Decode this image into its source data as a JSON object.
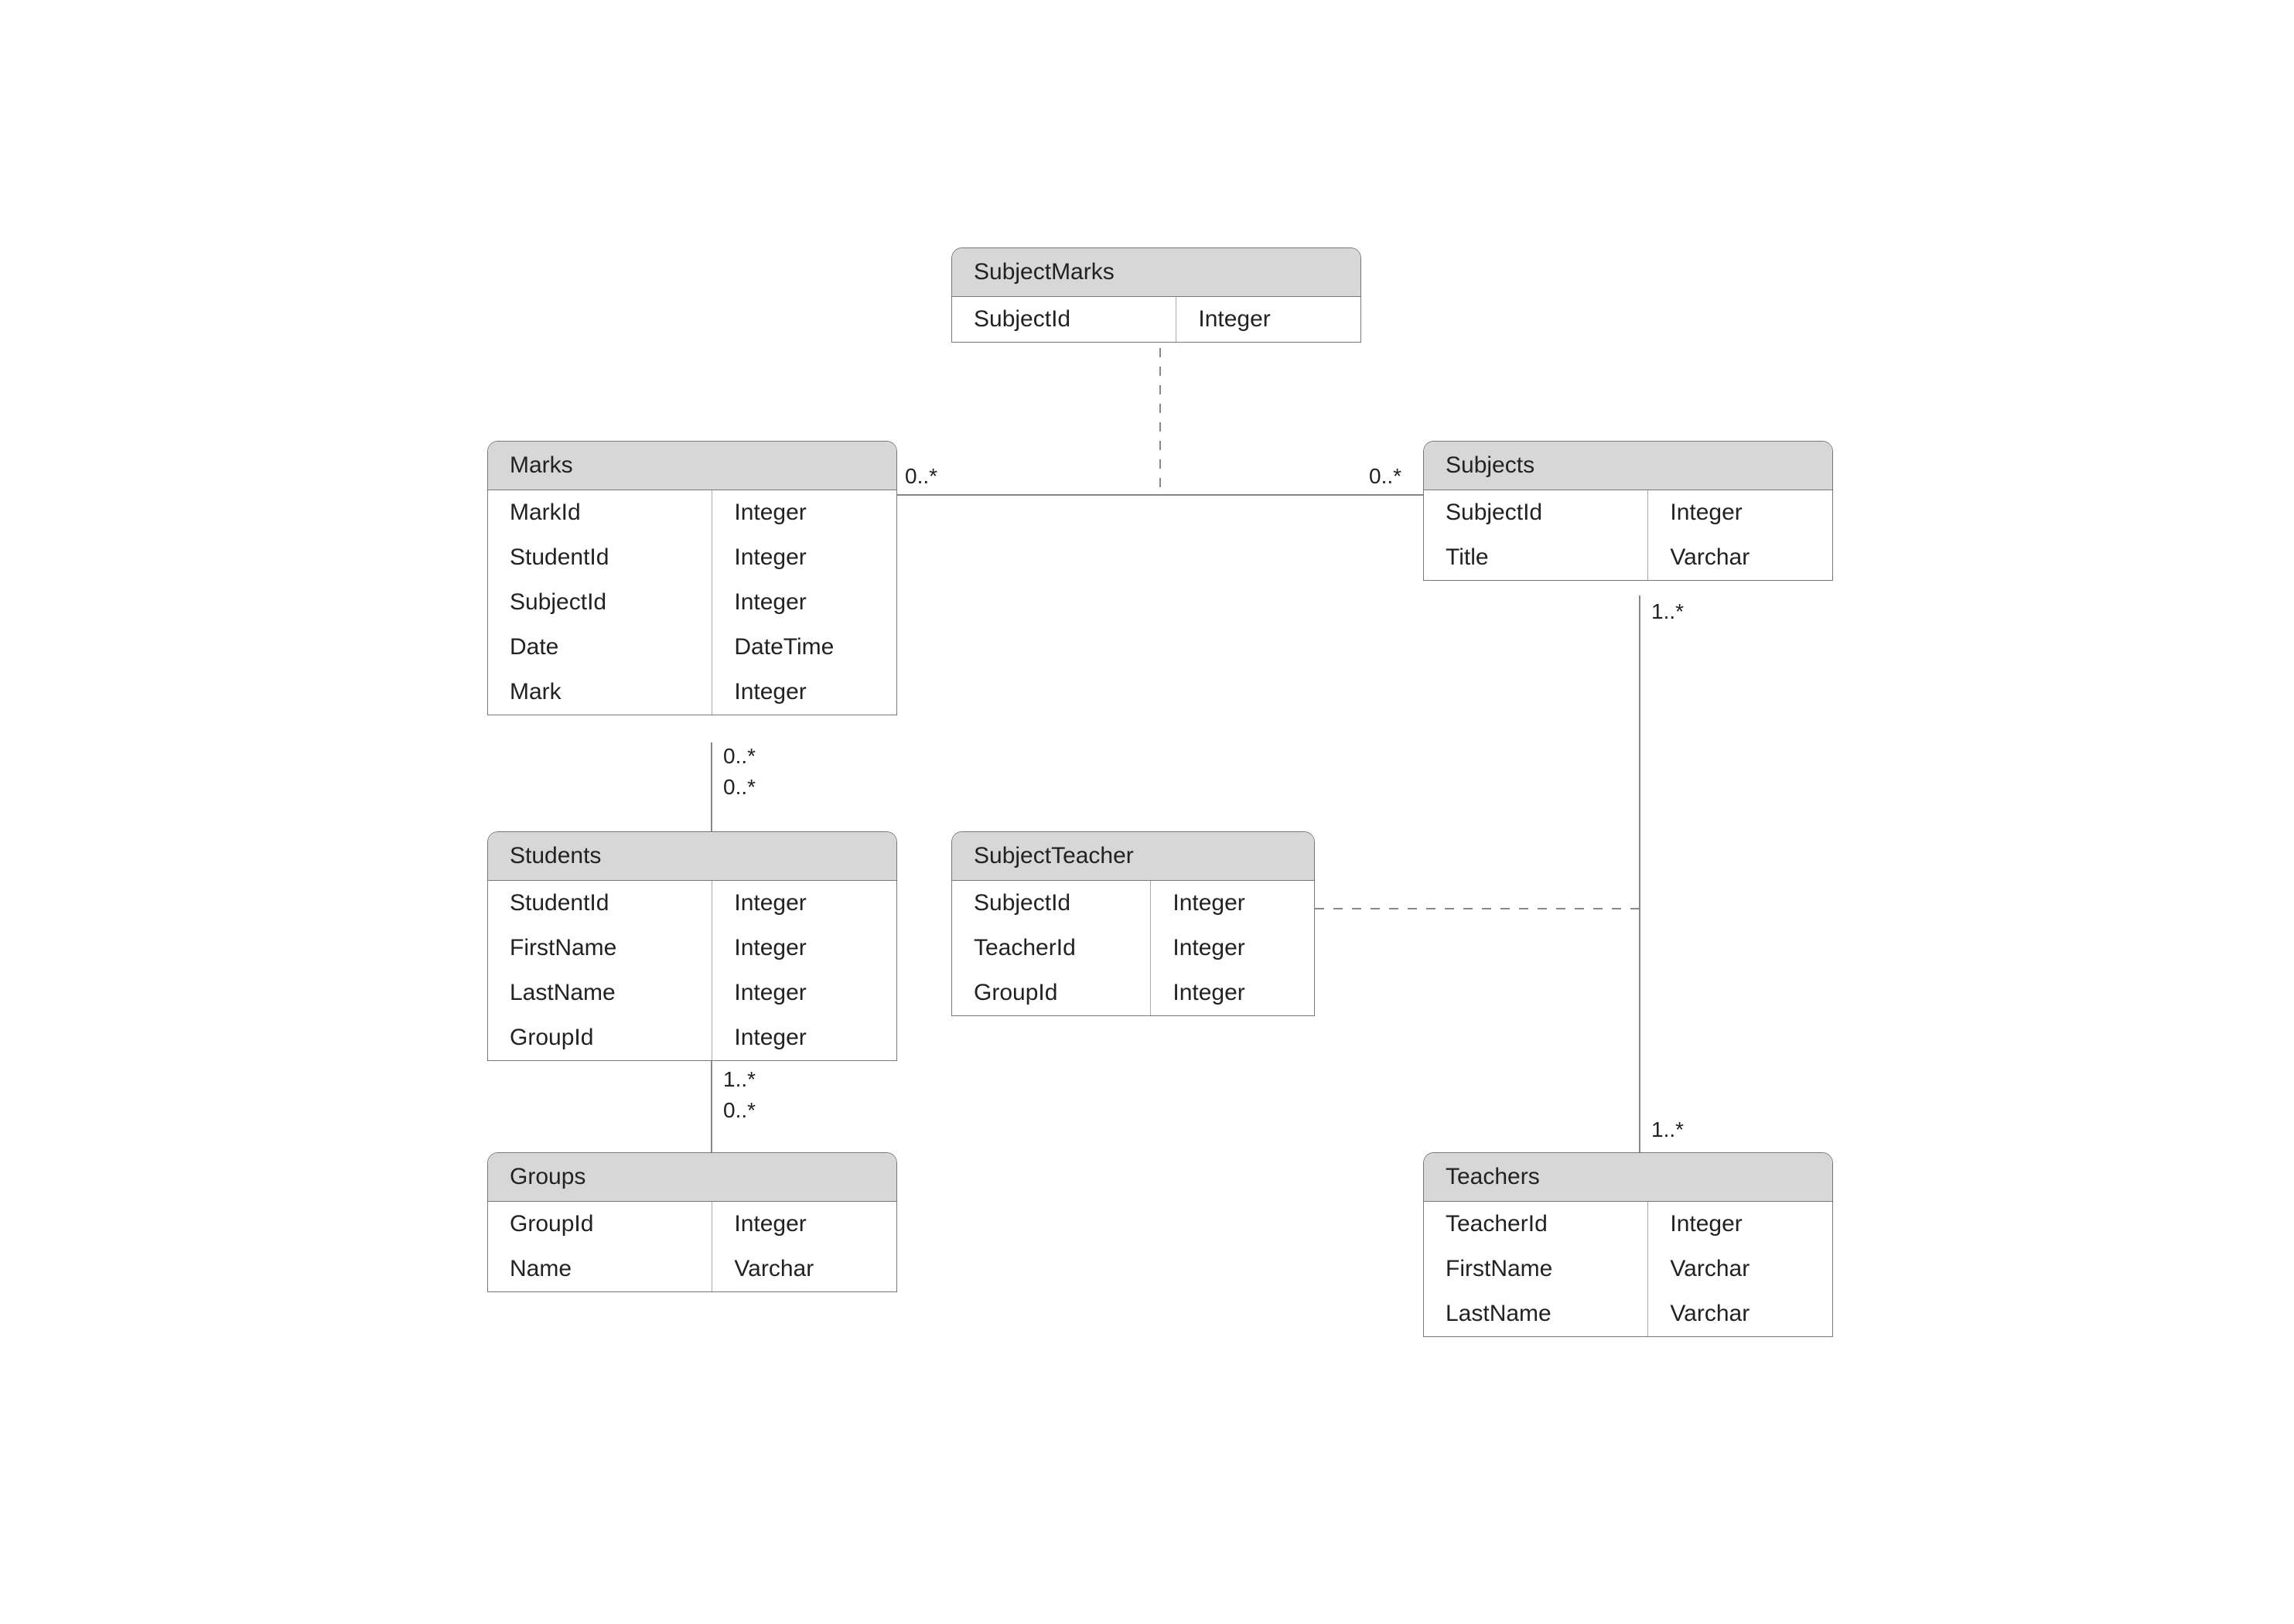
{
  "diagram": {
    "entities": {
      "subjectMarks": {
        "title": "SubjectMarks",
        "rows": [
          {
            "name": "SubjectId",
            "type": "Integer"
          }
        ]
      },
      "marks": {
        "title": "Marks",
        "rows": [
          {
            "name": "MarkId",
            "type": "Integer"
          },
          {
            "name": "StudentId",
            "type": "Integer"
          },
          {
            "name": "SubjectId",
            "type": "Integer"
          },
          {
            "name": "Date",
            "type": "DateTime"
          },
          {
            "name": "Mark",
            "type": "Integer"
          }
        ]
      },
      "subjects": {
        "title": "Subjects",
        "rows": [
          {
            "name": "SubjectId",
            "type": "Integer"
          },
          {
            "name": "Title",
            "type": "Varchar"
          }
        ]
      },
      "students": {
        "title": "Students",
        "rows": [
          {
            "name": "StudentId",
            "type": "Integer"
          },
          {
            "name": "FirstName",
            "type": "Integer"
          },
          {
            "name": "LastName",
            "type": "Integer"
          },
          {
            "name": "GroupId",
            "type": "Integer"
          }
        ]
      },
      "subjectTeacher": {
        "title": "SubjectTeacher",
        "rows": [
          {
            "name": "SubjectId",
            "type": "Integer"
          },
          {
            "name": "TeacherId",
            "type": "Integer"
          },
          {
            "name": "GroupId",
            "type": "Integer"
          }
        ]
      },
      "groups": {
        "title": "Groups",
        "rows": [
          {
            "name": "GroupId",
            "type": "Integer"
          },
          {
            "name": "Name",
            "type": "Varchar"
          }
        ]
      },
      "teachers": {
        "title": "Teachers",
        "rows": [
          {
            "name": "TeacherId",
            "type": "Integer"
          },
          {
            "name": "FirstName",
            "type": "Varchar"
          },
          {
            "name": "LastName",
            "type": "Varchar"
          }
        ]
      }
    },
    "multiplicities": {
      "marks_subjects_left": "0..*",
      "marks_subjects_right": "0..*",
      "marks_students_top": "0..*",
      "marks_students_bottom": "0..*",
      "students_groups_top": "1..*",
      "students_groups_bottom": "0..*",
      "subjects_teachers_top": "1..*",
      "subjects_teachers_bottom": "1..*"
    }
  }
}
